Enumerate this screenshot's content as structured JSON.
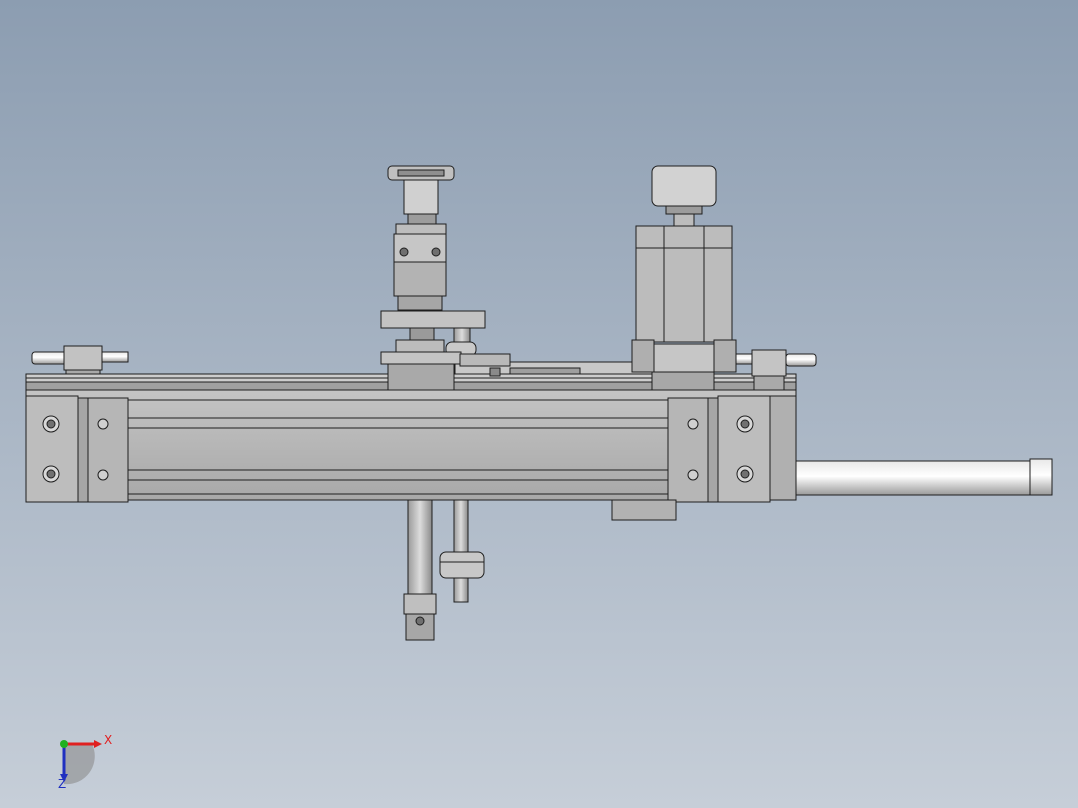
{
  "viewport": {
    "background_top": "#8c9db1",
    "background_bottom": "#c6ced8"
  },
  "model": {
    "metal_light": "#cfcfcf",
    "metal_mid": "#b4b4b4",
    "metal_dark": "#8e8e8e",
    "edge": "#1e1e1e"
  },
  "triad": {
    "x_label": "X",
    "z_label": "Z",
    "x_color": "#e02020",
    "y_color": "#20b020",
    "z_color": "#2030c0"
  }
}
